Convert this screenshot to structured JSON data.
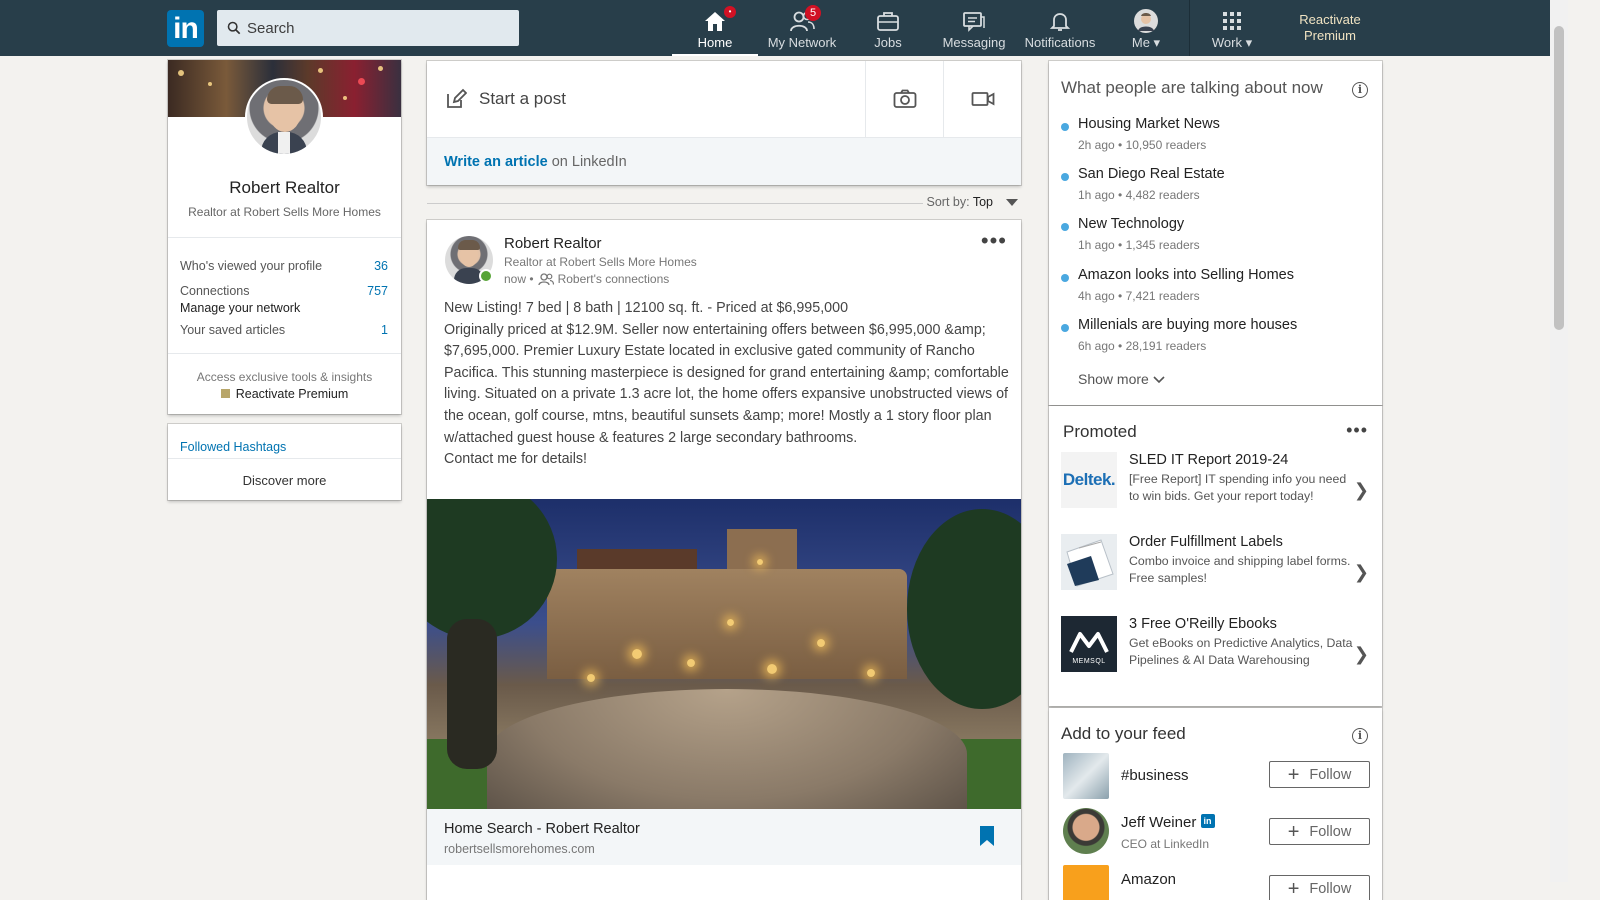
{
  "nav": {
    "logo": "in",
    "search_placeholder": "Search",
    "items": [
      {
        "label": "Home",
        "badge": "•"
      },
      {
        "label": "My Network",
        "badge": "5"
      },
      {
        "label": "Jobs"
      },
      {
        "label": "Messaging"
      },
      {
        "label": "Notifications"
      },
      {
        "label": "Me ▾"
      },
      {
        "label": "Work ▾"
      }
    ],
    "premium_line1": "Reactivate",
    "premium_line2": "Premium",
    "colors": {
      "bar": "#283e4a",
      "brand": "#0073b1",
      "badge": "#d11124"
    }
  },
  "profile": {
    "name": "Robert Realtor",
    "headline": "Realtor at Robert Sells More Homes",
    "stats": [
      {
        "label": "Who's viewed your profile",
        "value": "36"
      },
      {
        "label": "Connections",
        "value": "757"
      },
      {
        "label": "Your saved articles",
        "value": "1"
      }
    ],
    "manage_network": "Manage your network",
    "access_text": "Access exclusive tools & insights",
    "reactivate": "Reactivate Premium"
  },
  "hashtags": {
    "title": "Followed Hashtags",
    "discover": "Discover more"
  },
  "share": {
    "start_post": "Start a post",
    "write_article": "Write an article",
    "on_linkedin": " on LinkedIn"
  },
  "sort": {
    "label": "Sort by: ",
    "value": "Top"
  },
  "post": {
    "author": "Robert Realtor",
    "headline": "Realtor at Robert Sells More Homes",
    "time": "now •",
    "visibility": "Robert's connections",
    "body": "New Listing! 7 bed  | 8 bath  | 12100 sq. ft.  - Priced at $6,995,000\nOriginally priced at $12.9M. Seller now entertaining offers between $6,995,000 &amp; $7,695,000. Premier Luxury Estate located in exclusive gated community of Rancho Pacifica. This stunning masterpiece is designed for grand entertaining &amp; comfortable living. Situated on a private 1.3 acre lot, the home offers expansive unobstructed views of the ocean, golf course, mtns, beautiful sunsets &amp; more! Mostly a 1 story floor plan w/attached guest house & features 2 large secondary bathrooms.\nContact me for details!",
    "link_title": "Home Search - Robert Realtor",
    "link_url": "robertsellsmorehomes.com"
  },
  "news": {
    "title": "What people are talking about now",
    "items": [
      {
        "title": "Housing Market News",
        "meta": "2h ago • 10,950 readers"
      },
      {
        "title": "San Diego Real Estate",
        "meta": "1h ago • 4,482 readers"
      },
      {
        "title": "New Technology",
        "meta": "1h ago • 1,345 readers"
      },
      {
        "title": "Amazon looks into Selling Homes",
        "meta": "4h ago • 7,421 readers"
      },
      {
        "title": "Millenials are buying more houses",
        "meta": "6h ago • 28,191 readers"
      }
    ],
    "show_more": "Show more"
  },
  "promoted": {
    "title": "Promoted",
    "ads": [
      {
        "logo": "Deltek.",
        "title": "SLED IT Report 2019-24",
        "desc": "[Free Report] IT spending info you need to win bids. Get your report today!"
      },
      {
        "logo": "",
        "title": "Order Fulfillment Labels",
        "desc": "Combo invoice and shipping label forms. Free samples!"
      },
      {
        "logo": "MEMSQL",
        "title": "3 Free O'Reilly Ebooks",
        "desc": "Get eBooks on Predictive Analytics, Data Pipelines & AI Data Warehousing"
      }
    ]
  },
  "add_feed": {
    "title": "Add to your feed",
    "items": [
      {
        "name": "#business",
        "sub": "",
        "button": "Follow"
      },
      {
        "name": "Jeff Weiner",
        "sub": "CEO at LinkedIn",
        "button": "Follow"
      },
      {
        "name": "Amazon",
        "sub": "",
        "button": "Follow"
      }
    ]
  }
}
